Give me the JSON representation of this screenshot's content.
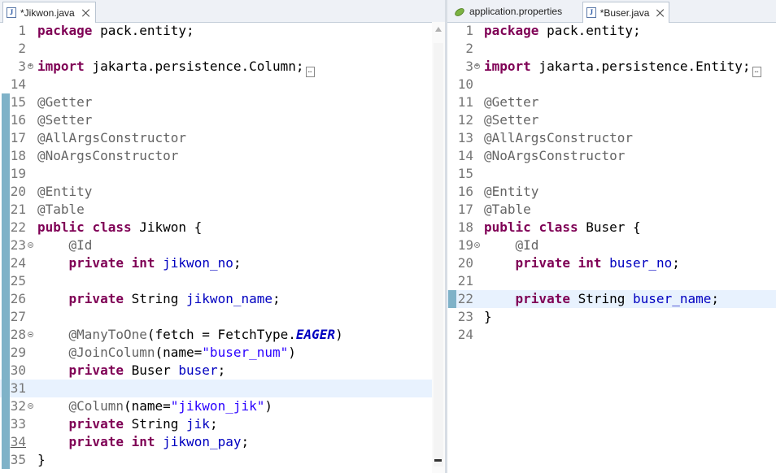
{
  "left_editor": {
    "tab": {
      "label": "*Jikwon.java",
      "icon": "java-file-icon"
    },
    "lines": [
      {
        "num": "1",
        "tokens": [
          [
            "kw",
            "package"
          ],
          [
            "pl",
            " pack.entity;"
          ]
        ]
      },
      {
        "num": "2",
        "tokens": []
      },
      {
        "num": "3",
        "fold": "plus",
        "collapsed": true,
        "tokens": [
          [
            "kw",
            "import"
          ],
          [
            "pl",
            " jakarta.persistence.Column;"
          ]
        ]
      },
      {
        "num": "14",
        "tokens": []
      },
      {
        "num": "15",
        "changed": true,
        "tokens": [
          [
            "ann",
            "@Getter"
          ]
        ]
      },
      {
        "num": "16",
        "changed": true,
        "tokens": [
          [
            "ann",
            "@Setter"
          ]
        ]
      },
      {
        "num": "17",
        "changed": true,
        "tokens": [
          [
            "ann",
            "@AllArgsConstructor"
          ]
        ]
      },
      {
        "num": "18",
        "changed": true,
        "tokens": [
          [
            "ann",
            "@NoArgsConstructor"
          ]
        ]
      },
      {
        "num": "19",
        "changed": true,
        "tokens": []
      },
      {
        "num": "20",
        "changed": true,
        "tokens": [
          [
            "ann",
            "@Entity"
          ]
        ]
      },
      {
        "num": "21",
        "changed": true,
        "tokens": [
          [
            "ann",
            "@Table"
          ]
        ]
      },
      {
        "num": "22",
        "changed": true,
        "tokens": [
          [
            "kw",
            "public"
          ],
          [
            "pl",
            " "
          ],
          [
            "kw",
            "class"
          ],
          [
            "pl",
            " Jikwon {"
          ]
        ]
      },
      {
        "num": "23",
        "changed": true,
        "fold": "minus",
        "tokens": [
          [
            "pl",
            "    "
          ],
          [
            "ann",
            "@Id"
          ]
        ]
      },
      {
        "num": "24",
        "changed": true,
        "tokens": [
          [
            "pl",
            "    "
          ],
          [
            "kw",
            "private"
          ],
          [
            "pl",
            " "
          ],
          [
            "kw",
            "int"
          ],
          [
            "pl",
            " "
          ],
          [
            "fld",
            "jikwon_no"
          ],
          [
            "pl",
            ";"
          ]
        ]
      },
      {
        "num": "25",
        "changed": true,
        "tokens": []
      },
      {
        "num": "26",
        "changed": true,
        "tokens": [
          [
            "pl",
            "    "
          ],
          [
            "kw",
            "private"
          ],
          [
            "pl",
            " String "
          ],
          [
            "fld",
            "jikwon_name"
          ],
          [
            "pl",
            ";"
          ]
        ]
      },
      {
        "num": "27",
        "changed": true,
        "tokens": []
      },
      {
        "num": "28",
        "changed": true,
        "fold": "minus",
        "tokens": [
          [
            "pl",
            "    "
          ],
          [
            "ann",
            "@ManyToOne"
          ],
          [
            "pl",
            "(fetch = FetchType."
          ],
          [
            "sta",
            "EAGER"
          ],
          [
            "pl",
            ")"
          ]
        ]
      },
      {
        "num": "29",
        "changed": true,
        "tokens": [
          [
            "pl",
            "    "
          ],
          [
            "ann",
            "@JoinColumn"
          ],
          [
            "pl",
            "(name="
          ],
          [
            "str",
            "\"buser_num\""
          ],
          [
            "pl",
            ")"
          ]
        ]
      },
      {
        "num": "30",
        "changed": true,
        "tokens": [
          [
            "pl",
            "    "
          ],
          [
            "kw",
            "private"
          ],
          [
            "pl",
            " Buser "
          ],
          [
            "fld",
            "buser"
          ],
          [
            "pl",
            ";"
          ]
        ]
      },
      {
        "num": "31",
        "changed": true,
        "current": true,
        "tokens": []
      },
      {
        "num": "32",
        "changed": true,
        "fold": "minus",
        "tokens": [
          [
            "pl",
            "    "
          ],
          [
            "ann",
            "@Column"
          ],
          [
            "pl",
            "(name="
          ],
          [
            "str",
            "\"jikwon_jik\""
          ],
          [
            "pl",
            ")"
          ]
        ]
      },
      {
        "num": "33",
        "changed": true,
        "tokens": [
          [
            "pl",
            "    "
          ],
          [
            "kw",
            "private"
          ],
          [
            "pl",
            " String "
          ],
          [
            "fld",
            "jik"
          ],
          [
            "pl",
            ";"
          ]
        ]
      },
      {
        "num": "34",
        "changed": true,
        "underline": true,
        "tokens": [
          [
            "pl",
            "    "
          ],
          [
            "kw",
            "private"
          ],
          [
            "pl",
            " "
          ],
          [
            "kw",
            "int"
          ],
          [
            "pl",
            " "
          ],
          [
            "fld",
            "jikwon_pay"
          ],
          [
            "pl",
            ";"
          ]
        ]
      },
      {
        "num": "35",
        "changed": true,
        "tokens": [
          [
            "pl",
            "}"
          ]
        ]
      }
    ]
  },
  "right_editor": {
    "tabs": [
      {
        "label": "application.properties",
        "icon": "properties-file-icon",
        "active": false
      },
      {
        "label": "*Buser.java",
        "icon": "java-file-icon",
        "active": true
      }
    ],
    "lines": [
      {
        "num": "1",
        "tokens": [
          [
            "kw",
            "package"
          ],
          [
            "pl",
            " pack.entity;"
          ]
        ]
      },
      {
        "num": "2",
        "tokens": []
      },
      {
        "num": "3",
        "fold": "plus",
        "collapsed": true,
        "tokens": [
          [
            "kw",
            "import"
          ],
          [
            "pl",
            " jakarta.persistence.Entity;"
          ]
        ]
      },
      {
        "num": "10",
        "tokens": []
      },
      {
        "num": "11",
        "tokens": [
          [
            "ann",
            "@Getter"
          ]
        ]
      },
      {
        "num": "12",
        "tokens": [
          [
            "ann",
            "@Setter"
          ]
        ]
      },
      {
        "num": "13",
        "tokens": [
          [
            "ann",
            "@AllArgsConstructor"
          ]
        ]
      },
      {
        "num": "14",
        "tokens": [
          [
            "ann",
            "@NoArgsConstructor"
          ]
        ]
      },
      {
        "num": "15",
        "tokens": []
      },
      {
        "num": "16",
        "tokens": [
          [
            "ann",
            "@Entity"
          ]
        ]
      },
      {
        "num": "17",
        "tokens": [
          [
            "ann",
            "@Table"
          ]
        ]
      },
      {
        "num": "18",
        "tokens": [
          [
            "kw",
            "public"
          ],
          [
            "pl",
            " "
          ],
          [
            "kw",
            "class"
          ],
          [
            "pl",
            " Buser {"
          ]
        ]
      },
      {
        "num": "19",
        "fold": "minus",
        "tokens": [
          [
            "pl",
            "    "
          ],
          [
            "ann",
            "@Id"
          ]
        ]
      },
      {
        "num": "20",
        "tokens": [
          [
            "pl",
            "    "
          ],
          [
            "kw",
            "private"
          ],
          [
            "pl",
            " "
          ],
          [
            "kw",
            "int"
          ],
          [
            "pl",
            " "
          ],
          [
            "fld",
            "buser_no"
          ],
          [
            "pl",
            ";"
          ]
        ]
      },
      {
        "num": "21",
        "tokens": []
      },
      {
        "num": "22",
        "changed": true,
        "current": true,
        "tokens": [
          [
            "pl",
            "    "
          ],
          [
            "kw",
            "private"
          ],
          [
            "pl",
            " String "
          ],
          [
            "fld",
            "buser_name"
          ],
          [
            "pl",
            ";"
          ]
        ]
      },
      {
        "num": "23",
        "tokens": [
          [
            "pl",
            "}"
          ]
        ]
      },
      {
        "num": "24",
        "tokens": []
      }
    ]
  }
}
